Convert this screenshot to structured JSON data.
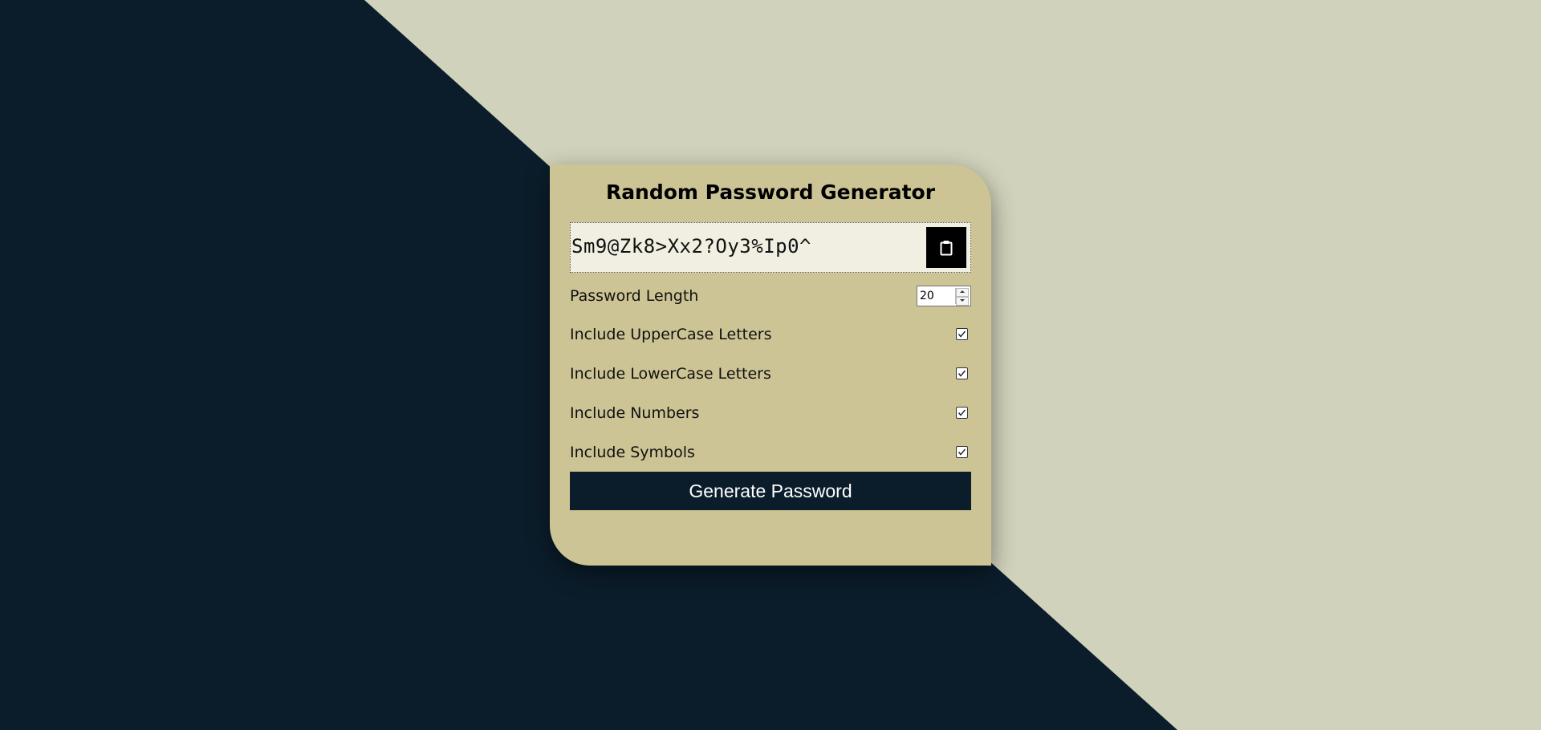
{
  "app": {
    "title": "Random Password Generator"
  },
  "password": {
    "value": "Sm9@Zk8>Xx2?Oy3%Ip0^",
    "copy_icon": "clipboard-icon"
  },
  "length": {
    "label": "Password Length",
    "value": "20"
  },
  "options": [
    {
      "label": "Include UpperCase Letters",
      "checked": true
    },
    {
      "label": "Include LowerCase Letters",
      "checked": true
    },
    {
      "label": "Include Numbers",
      "checked": true
    },
    {
      "label": "Include Symbols",
      "checked": true
    }
  ],
  "generate_button": {
    "label": "Generate Password"
  },
  "colors": {
    "dark_background": "#0b1d2b",
    "light_background": "#d0d2bb",
    "card": "#cdc495",
    "result_box": "#f1eee2",
    "button": "#0b1d2b"
  }
}
